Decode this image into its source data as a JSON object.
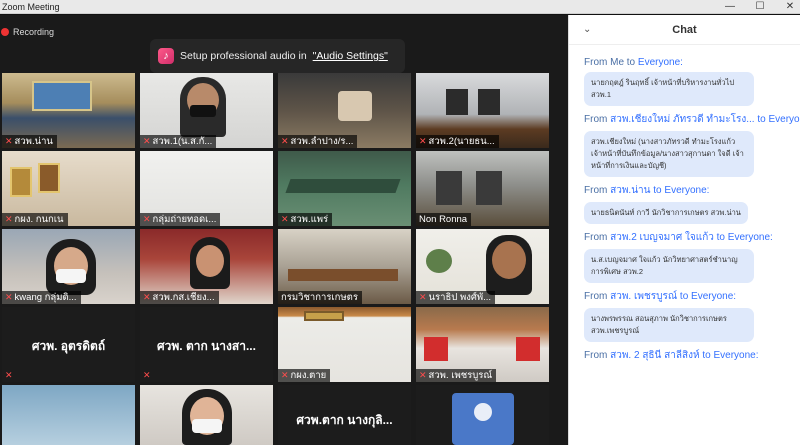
{
  "window": {
    "title": "Zoom Meeting",
    "minimize": "—",
    "maximize": "☐",
    "close": "✕"
  },
  "recording": {
    "label": "Recording"
  },
  "audio_tip": {
    "text": "Setup professional audio in ",
    "link": "\"Audio Settings\""
  },
  "participants": [
    "สวพ.น่าน",
    "สวพ.1(น.ส.กั...",
    "สวพ.ลำปาง/ร...",
    "สวพ.2(นายธน...",
    "กผง. กนกเน",
    "กลุ่มถ่ายทอดเ...",
    "สวพ.แพร่",
    "Non Ronna",
    "kwang กลุ่มดิ...",
    "สวพ.กส.เชียง...",
    "กรมวิชาการเกษตร",
    "นราธิป พงศ์พั...",
    "",
    "",
    "กผง.ตาย",
    "สวพ. เพชรบูรณ์"
  ],
  "big_names": {
    "t13": "ศวพ. อุตรดิตถ์",
    "t14": "ศวพ. ตาก  นางสา...",
    "t19": "ศวพ.ตาก  นางกุลิ..."
  },
  "chat": {
    "title": "Chat",
    "messages": [
      {
        "from": "From Me to ",
        "sender": "",
        "to": "Everyone:",
        "text": "นายกฤตฎ์ รินฤทธิ์ เจ้าหน้าที่บริหารงานทั่วไป สวพ.1"
      },
      {
        "from": "From ",
        "sender": "สวพ.เชียงใหม่ ภัทรวดี ทำมะโรง...",
        "to": " to Everyone",
        "text": "สวพ.เชียงใหม่ (นางสาวภัทรวดี ทำมะโรงแก้ว เจ้าหน้าที่บันทึกข้อมูล/นางสาวสุกานดา ใจดี เจ้าหน้าที่การเงินและบัญชี)"
      },
      {
        "from": "From ",
        "sender": "สวพ.น่าน",
        "to": " to Everyone:",
        "text": "นายธนิตนันท์ กาวี นักวิชาการเกษตร สวพ.น่าน"
      },
      {
        "from": "From ",
        "sender": "สวพ.2 เบญจมาศ ใจแก้ว",
        "to": " to Everyone:",
        "text": "น.ส.เบญจมาศ ใจแก้ว นักวิทยาศาสตร์ชำนาญการพิเศษ สวพ.2"
      },
      {
        "from": "From ",
        "sender": "สวพ. เพชรบูรณ์",
        "to": " to Everyone:",
        "text": "นางพรพรรณ สอนสุภาพ นักวิชาการเกษตร สวพ.เพชรบูรณ์"
      },
      {
        "from": "From ",
        "sender": "สวพ. 2 สุธินี สาลีสิงห์",
        "to": " to Everyone:",
        "text": ""
      }
    ]
  }
}
